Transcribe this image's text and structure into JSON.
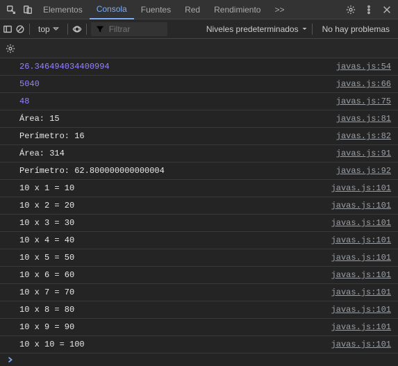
{
  "tabs": {
    "items": [
      "Elementos",
      "Consola",
      "Fuentes",
      "Red",
      "Rendimiento"
    ],
    "active": 1,
    "more": ">>"
  },
  "toolbar": {
    "context": "top",
    "filter_placeholder": "Filtrar",
    "levels_label": "Niveles predeterminados",
    "status": "No hay problemas"
  },
  "console_rows": [
    {
      "text": "26.346494034400994",
      "type": "num",
      "src": "javas.js:54"
    },
    {
      "text": "5040",
      "type": "num",
      "src": "javas.js:66"
    },
    {
      "text": "48",
      "type": "num",
      "src": "javas.js:75"
    },
    {
      "text": "Área: 15",
      "type": "str",
      "src": "javas.js:81"
    },
    {
      "text": "Perímetro: 16",
      "type": "str",
      "src": "javas.js:82"
    },
    {
      "text": "Área: 314",
      "type": "str",
      "src": "javas.js:91"
    },
    {
      "text": "Perímetro: 62.800000000000004",
      "type": "str",
      "src": "javas.js:92"
    },
    {
      "text": "10 x 1 = 10",
      "type": "str",
      "src": "javas.js:101"
    },
    {
      "text": "10 x 2 = 20",
      "type": "str",
      "src": "javas.js:101"
    },
    {
      "text": "10 x 3 = 30",
      "type": "str",
      "src": "javas.js:101"
    },
    {
      "text": "10 x 4 = 40",
      "type": "str",
      "src": "javas.js:101"
    },
    {
      "text": "10 x 5 = 50",
      "type": "str",
      "src": "javas.js:101"
    },
    {
      "text": "10 x 6 = 60",
      "type": "str",
      "src": "javas.js:101"
    },
    {
      "text": "10 x 7 = 70",
      "type": "str",
      "src": "javas.js:101"
    },
    {
      "text": "10 x 8 = 80",
      "type": "str",
      "src": "javas.js:101"
    },
    {
      "text": "10 x 9 = 90",
      "type": "str",
      "src": "javas.js:101"
    },
    {
      "text": "10 x 10 = 100",
      "type": "str",
      "src": "javas.js:101"
    }
  ]
}
